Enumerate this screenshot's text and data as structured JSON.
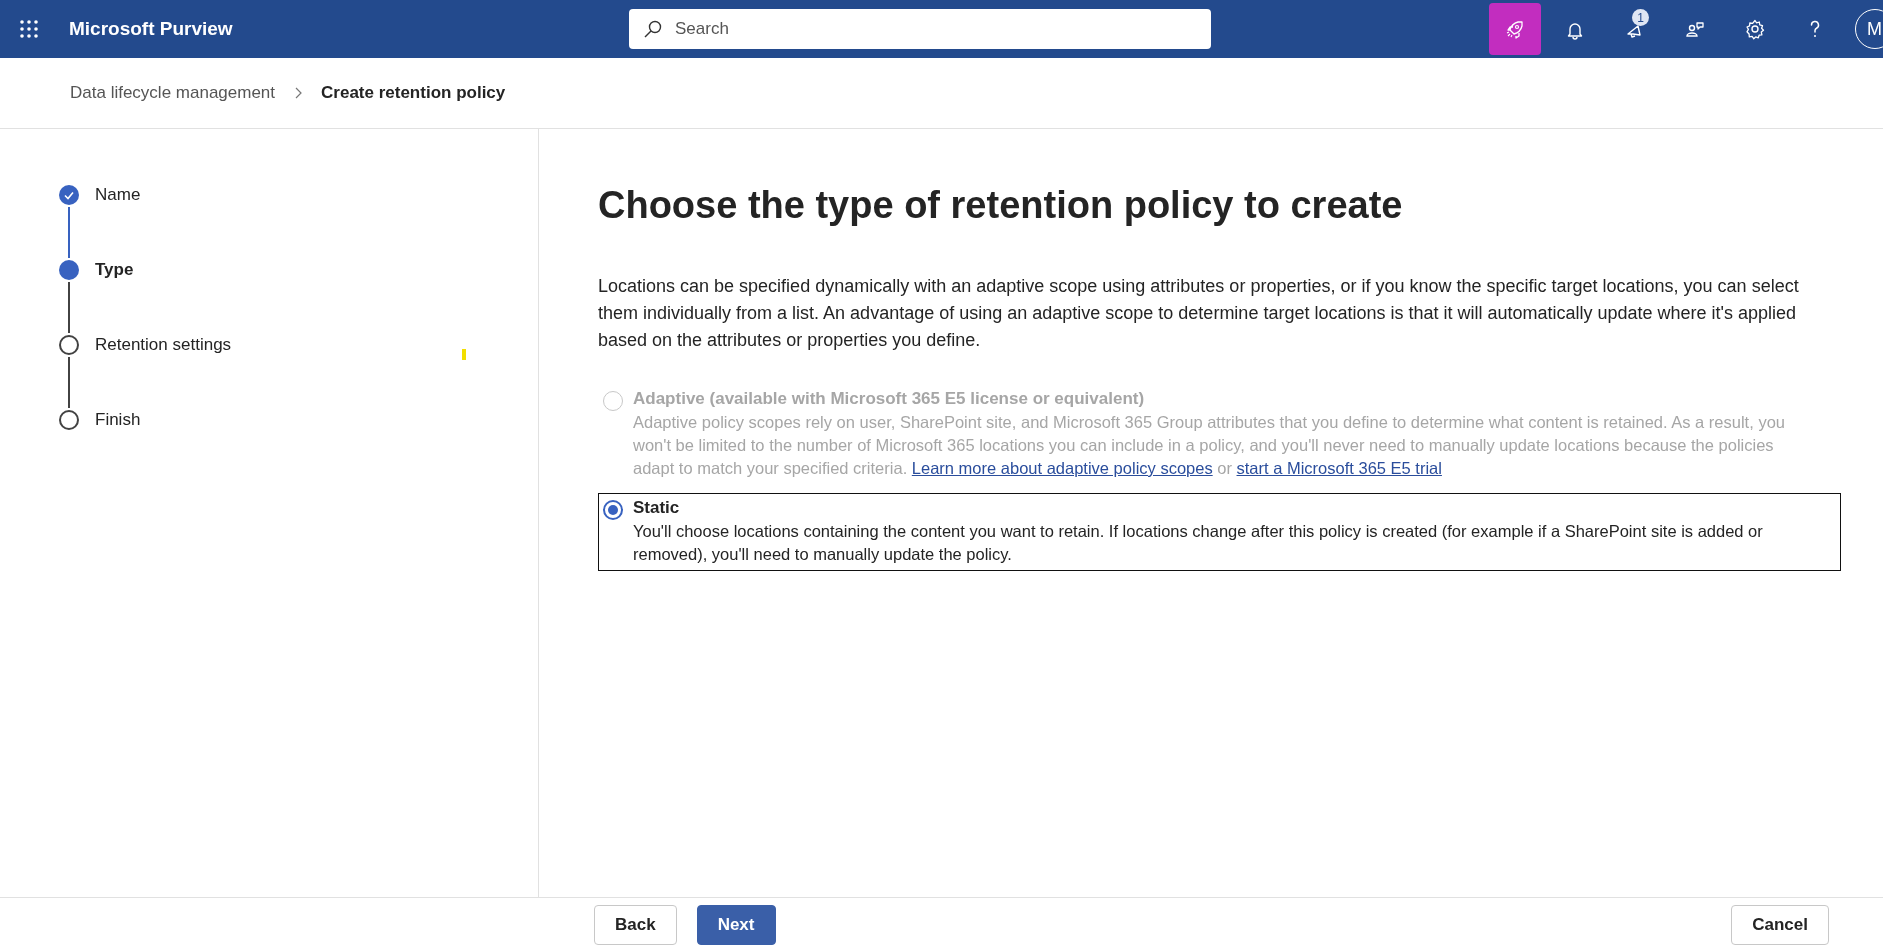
{
  "header": {
    "app_title": "Microsoft Purview",
    "search": {
      "placeholder": "Search"
    },
    "actions": [
      {
        "kind": "rocket",
        "highlighted": true
      },
      {
        "kind": "bell",
        "highlighted": false
      },
      {
        "kind": "megaphone",
        "highlighted": false,
        "badge": "1"
      },
      {
        "kind": "people",
        "highlighted": false
      },
      {
        "kind": "gear",
        "highlighted": false
      },
      {
        "kind": "help",
        "highlighted": false
      }
    ],
    "avatar": "M"
  },
  "breadcrumb": [
    {
      "label": "Data lifecycle management",
      "current": false
    },
    {
      "label": "Create retention policy",
      "current": true
    }
  ],
  "steps": [
    {
      "label": "Name",
      "kind": "completed"
    },
    {
      "label": "Type",
      "kind": "current"
    },
    {
      "label": "Retention settings",
      "kind": "upcoming"
    },
    {
      "label": "Finish",
      "kind": "upcoming"
    }
  ],
  "content": {
    "title": "Choose the type of retention policy to create",
    "intro": "Locations can be specified dynamically with an adaptive scope using attributes or properties, or if you know the specific target locations, you can select them individually from a list. An advantage of using an adaptive scope to determine target locations is that it will automatically update where it's applied based on the attributes or properties you define.",
    "options": [
      {
        "label": "Adaptive (available with Microsoft 365 E5 license or equivalent)",
        "selected": false,
        "disabled": true,
        "focused": false,
        "description": "Adaptive policy scopes rely on user, SharePoint site, and Microsoft 365 Group attributes that you define to determine what content is retained. As a result, you won't be limited to the number of Microsoft 365 locations you can include in a policy, and you'll never need to manually update locations because the policies adapt to match your specified criteria.",
        "links": [
          "Learn more about adaptive policy scopes",
          "start a Microsoft 365 E5 trial"
        ],
        "links_joiner": "or"
      },
      {
        "label": "Static",
        "selected": true,
        "disabled": false,
        "focused": true,
        "description": "You'll choose locations containing the content you want to retain. If locations change after this policy is created (for example if a SharePoint site is added or removed), you'll need to manually update the policy."
      }
    ]
  },
  "footer": {
    "buttons": [
      {
        "label": "Back",
        "kind": "secondary"
      },
      {
        "label": "Next",
        "kind": "primary"
      },
      {
        "label": "Cancel",
        "kind": "cancel"
      }
    ]
  }
}
